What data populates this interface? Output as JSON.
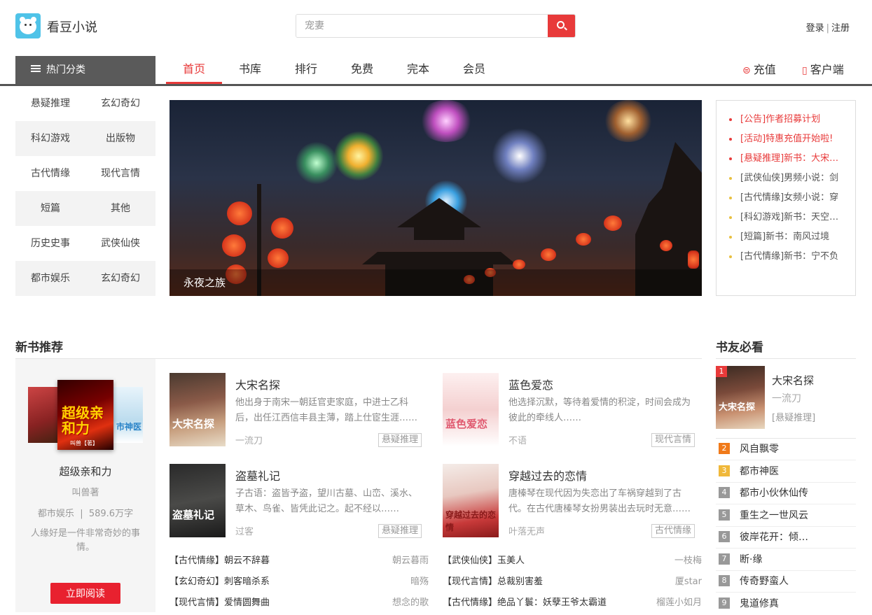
{
  "header": {
    "site_name": "看豆小说",
    "search_placeholder": "宠妻",
    "login": "登录",
    "sep": "|",
    "register": "注册"
  },
  "nav": {
    "hot": "热门分类",
    "items": [
      "首页",
      "书库",
      "排行",
      "免费",
      "完本",
      "会员"
    ],
    "recharge": "充值",
    "client": "客户端"
  },
  "categories": [
    [
      "悬疑推理",
      "玄幻奇幻"
    ],
    [
      "科幻游戏",
      "出版物"
    ],
    [
      "古代情缘",
      "现代言情"
    ],
    [
      "短篇",
      "其他"
    ],
    [
      "历史史事",
      "武侠仙侠"
    ],
    [
      "都市娱乐",
      "玄幻奇幻"
    ]
  ],
  "banner": {
    "caption": "永夜之族"
  },
  "notices": [
    "[公告]作者招募计划",
    "[活动]特惠充值开始啦!",
    "[悬疑推理]新书：大宋名探",
    "[武侠仙侠]男频小说：剑",
    "[古代情缘]女频小说：穿",
    "[科幻游戏]新书：天空之城",
    "[短篇]新书：南风过境",
    "[古代情缘]新书：宁不负"
  ],
  "new_books": {
    "title": "新书推荐",
    "featured": {
      "cover_text": "超级亲和力",
      "cover_text2": "市神医",
      "cover_author": "叫兽【著】",
      "title": "超级亲和力",
      "author": "叫兽著",
      "genre": "都市娱乐",
      "sep": "|",
      "words": "589.6万字",
      "desc": "人缘好是一件非常奇妙的事情。",
      "read_btn": "立即阅读"
    },
    "books": [
      {
        "title": "大宋名探",
        "cover": "大宋名探",
        "desc": "他出身于南宋一朝廷官吏家庭，中进士乙科后，出任江西信丰县主薄，踏上仕宦生涯……",
        "author": "一流刀",
        "tag": "悬疑推理"
      },
      {
        "title": "蓝色爱恋",
        "cover": "蓝色爱恋",
        "desc": "他选择沉默，等待着爱情的积淀，时间会成为彼此的牵线人……",
        "author": "不语",
        "tag": "现代言情"
      },
      {
        "title": "盗墓礼记",
        "cover": "盗墓礼记",
        "desc": "子古语：盗皆予盗，望川古墓、山峦、溪水、草木、鸟雀、皆凭此记之。起不经以……",
        "author": "过客",
        "tag": "悬疑推理"
      },
      {
        "title": "穿越过去的恋情",
        "cover": "穿越过去的恋情",
        "desc": "唐榛琴在现代因为失恋出了车祸穿越到了古代。在古代唐榛琴女扮男装出去玩时无意……",
        "author": "叶落无声",
        "tag": "古代情缘"
      }
    ],
    "list": [
      {
        "l": "【古代情缘】朝云不辞暮",
        "r": "朝云暮雨"
      },
      {
        "l": "【武侠仙侠】玉美人",
        "r": "一枝梅"
      },
      {
        "l": "【玄幻奇幻】刺客暗杀系",
        "r": "暗殇"
      },
      {
        "l": "【现代言情】总裁别害羞",
        "r": "厦star"
      },
      {
        "l": "【现代言情】爱情圆舞曲",
        "r": "想念的歌"
      },
      {
        "l": "【古代情缘】绝品丫鬟：妖孽王爷太霸道",
        "r": "榴莲小如月"
      }
    ]
  },
  "must_read": {
    "title": "书友必看",
    "top": {
      "rank": "1",
      "title": "大宋名探",
      "author": "一流刀",
      "tag": "[悬疑推理]",
      "cover": "大宋名探"
    },
    "items": [
      {
        "rank": "2",
        "title": "风自飘零",
        "color": "#f07a1a"
      },
      {
        "rank": "3",
        "title": "都市神医",
        "color": "#f0b83a"
      },
      {
        "rank": "4",
        "title": "都市小伙休仙传",
        "color": "#999999"
      },
      {
        "rank": "5",
        "title": "重生之一世风云",
        "color": "#999999"
      },
      {
        "rank": "6",
        "title": "彼岸花开：倾…",
        "color": "#999999"
      },
      {
        "rank": "7",
        "title": "断·缘",
        "color": "#999999"
      },
      {
        "rank": "8",
        "title": "传奇野蛮人",
        "color": "#999999"
      },
      {
        "rank": "9",
        "title": "鬼道修真",
        "color": "#999999"
      }
    ]
  }
}
